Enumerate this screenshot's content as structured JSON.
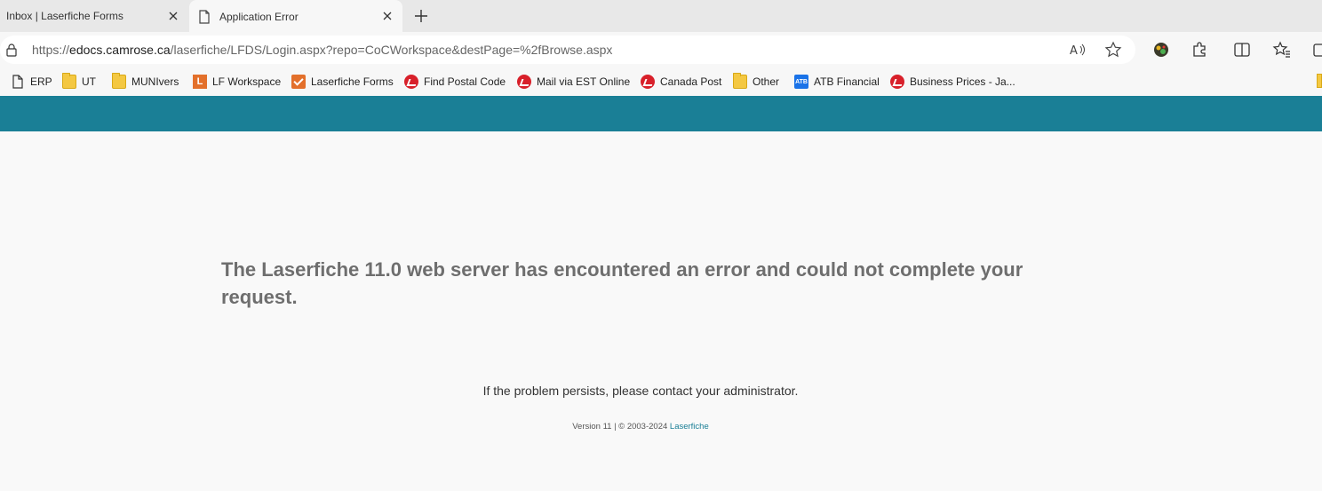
{
  "tabs": [
    {
      "title": "Inbox | Laserfiche Forms",
      "active": false
    },
    {
      "title": "Application Error",
      "active": true
    }
  ],
  "address_bar": {
    "url_scheme": "https://",
    "url_host": "edocs.camrose.ca",
    "url_path": "/laserfiche/LFDS/Login.aspx?repo=CoCWorkspace&destPage=%2fBrowse.aspx"
  },
  "bookmarks": [
    {
      "label": "ERP",
      "icon": "page-icon"
    },
    {
      "label": "UT",
      "icon": "folder-icon"
    },
    {
      "label": "MUNIvers",
      "icon": "folder-icon"
    },
    {
      "label": "LF Workspace",
      "icon": "laserfiche-icon"
    },
    {
      "label": "Laserfiche Forms",
      "icon": "forms-check-icon"
    },
    {
      "label": "Find Postal Code",
      "icon": "canada-post-icon"
    },
    {
      "label": "Mail via EST Online",
      "icon": "canada-post-icon"
    },
    {
      "label": "Canada Post",
      "icon": "canada-post-icon"
    },
    {
      "label": "Other",
      "icon": "folder-icon"
    },
    {
      "label": "ATB Financial",
      "icon": "atb-icon"
    },
    {
      "label": "Business Prices - Ja...",
      "icon": "canada-post-icon"
    }
  ],
  "page": {
    "error_title": "The Laserfiche 11.0 web server has encountered an error and could not complete your request.",
    "error_message": "If the problem persists, please contact your administrator.",
    "footer_text": "Version 11 | © 2003-2024 ",
    "footer_link": "Laserfiche"
  },
  "colors": {
    "banner": "#1a7f96",
    "background": "#f9f9f9"
  }
}
